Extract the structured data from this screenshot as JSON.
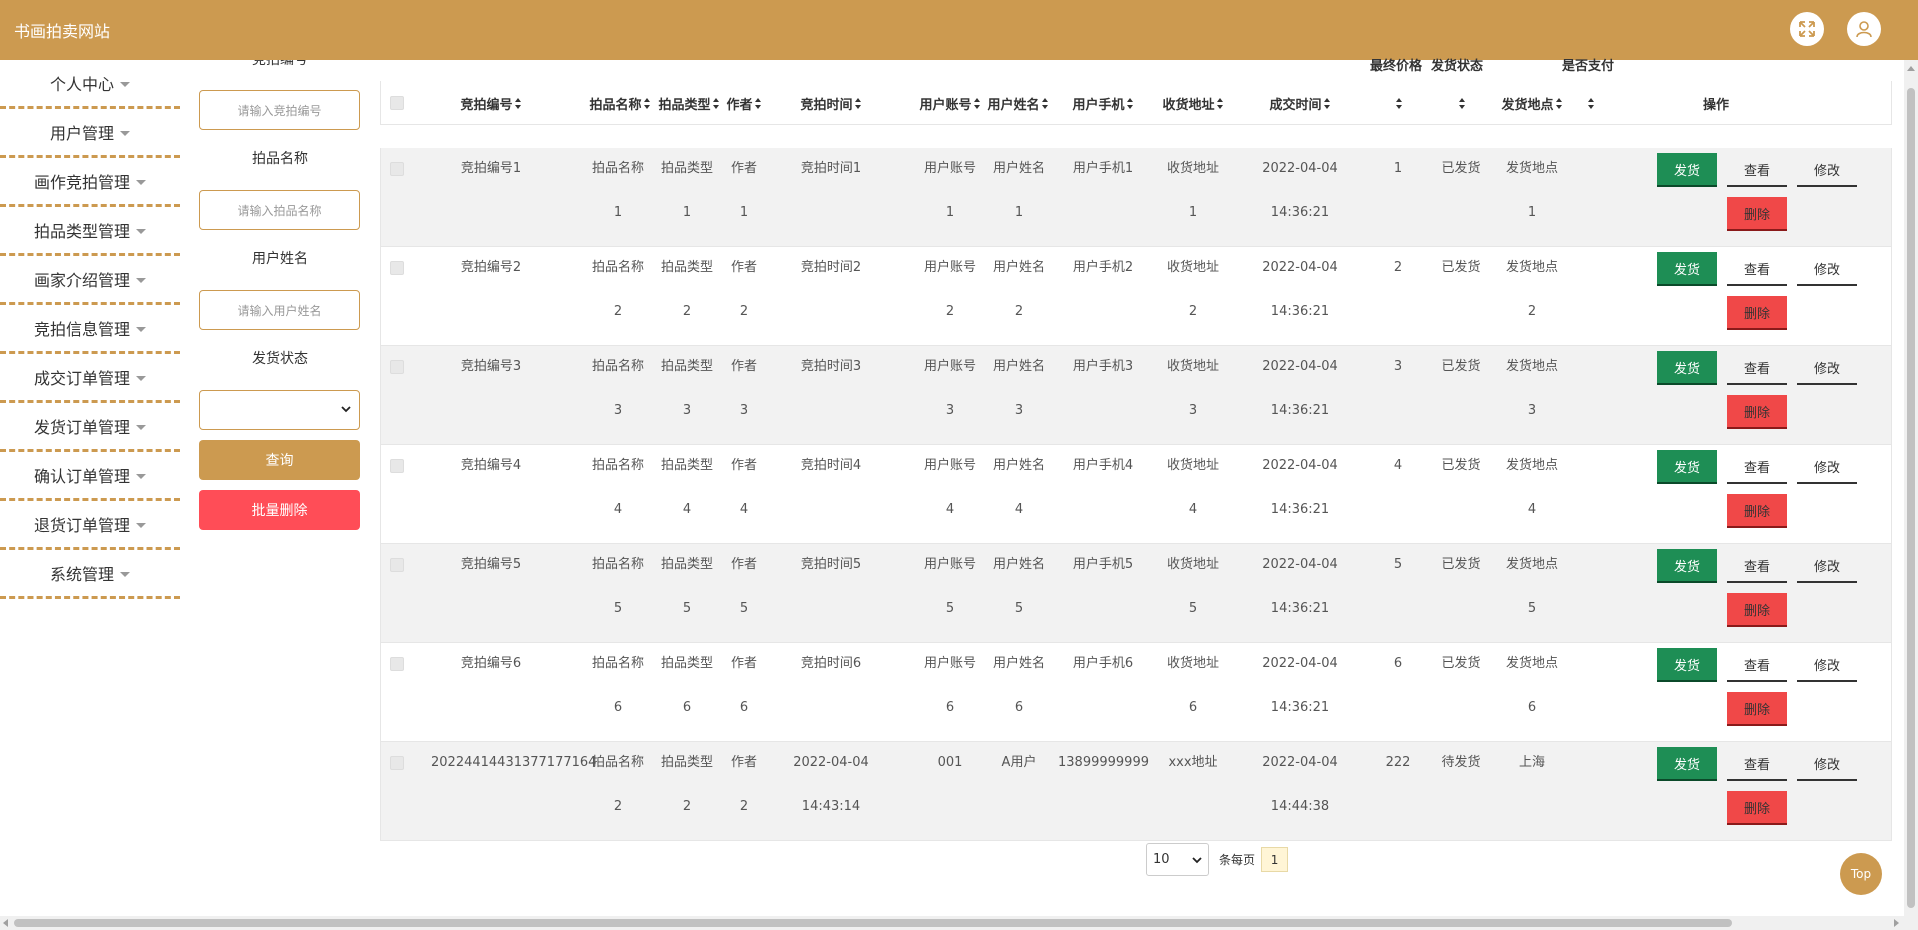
{
  "header": {
    "title": "书画拍卖网站",
    "expand_icon": "expand-icon",
    "user_icon": "user-icon"
  },
  "sidebar": {
    "items": [
      {
        "label": "个人中心"
      },
      {
        "label": "用户管理"
      },
      {
        "label": "画作竞拍管理"
      },
      {
        "label": "拍品类型管理"
      },
      {
        "label": "画家介绍管理"
      },
      {
        "label": "竞拍信息管理"
      },
      {
        "label": "成交订单管理"
      },
      {
        "label": "发货订单管理"
      },
      {
        "label": "确认订单管理"
      },
      {
        "label": "退货订单管理"
      },
      {
        "label": "系统管理"
      }
    ]
  },
  "filter": {
    "top_label": "竞拍编号",
    "auction_no_placeholder": "请输入竞拍编号",
    "item_name_label": "拍品名称",
    "item_name_placeholder": "请输入拍品名称",
    "user_name_label": "用户姓名",
    "user_name_placeholder": "请输入用户姓名",
    "ship_status_label": "发货状态",
    "ship_status_value": "",
    "query_label": "查询",
    "batch_delete_label": "批量删除"
  },
  "table": {
    "top_labels": {
      "final_price": "最终价格",
      "ship_status": "发货状态",
      "paid": "是否支付"
    },
    "headers": {
      "auction_no": "竞拍编号",
      "item_name": "拍品名称",
      "item_type": "拍品类型",
      "author": "作者",
      "auction_time": "竞拍时间",
      "user_account": "用户账号",
      "user_name": "用户姓名",
      "user_phone": "用户手机",
      "address": "收货地址",
      "deal_time": "成交时间",
      "ship_place": "发货地点",
      "actions": "操作"
    },
    "rows": [
      {
        "auction_no": "竞拍编号1",
        "item_name": "拍品名称",
        "item_name2": "1",
        "item_type": "拍品类型",
        "item_type2": "1",
        "author": "作者",
        "author2": "1",
        "auction_time": "竞拍时间1",
        "auction_time2": "",
        "user_account": "用户账号",
        "user_account2": "1",
        "user_name": "用户姓名",
        "user_name2": "1",
        "user_phone": "用户手机1",
        "address": "收货地址",
        "address2": "1",
        "deal_date": "2022-04-04",
        "deal_clock": "14:36:21",
        "final_price": "1",
        "ship_status": "已发货",
        "ship_place": "发货地点",
        "ship_place2": "1"
      },
      {
        "auction_no": "竞拍编号2",
        "item_name": "拍品名称",
        "item_name2": "2",
        "item_type": "拍品类型",
        "item_type2": "2",
        "author": "作者",
        "author2": "2",
        "auction_time": "竞拍时间2",
        "auction_time2": "",
        "user_account": "用户账号",
        "user_account2": "2",
        "user_name": "用户姓名",
        "user_name2": "2",
        "user_phone": "用户手机2",
        "address": "收货地址",
        "address2": "2",
        "deal_date": "2022-04-04",
        "deal_clock": "14:36:21",
        "final_price": "2",
        "ship_status": "已发货",
        "ship_place": "发货地点",
        "ship_place2": "2"
      },
      {
        "auction_no": "竞拍编号3",
        "item_name": "拍品名称",
        "item_name2": "3",
        "item_type": "拍品类型",
        "item_type2": "3",
        "author": "作者",
        "author2": "3",
        "auction_time": "竞拍时间3",
        "auction_time2": "",
        "user_account": "用户账号",
        "user_account2": "3",
        "user_name": "用户姓名",
        "user_name2": "3",
        "user_phone": "用户手机3",
        "address": "收货地址",
        "address2": "3",
        "deal_date": "2022-04-04",
        "deal_clock": "14:36:21",
        "final_price": "3",
        "ship_status": "已发货",
        "ship_place": "发货地点",
        "ship_place2": "3"
      },
      {
        "auction_no": "竞拍编号4",
        "item_name": "拍品名称",
        "item_name2": "4",
        "item_type": "拍品类型",
        "item_type2": "4",
        "author": "作者",
        "author2": "4",
        "auction_time": "竞拍时间4",
        "auction_time2": "",
        "user_account": "用户账号",
        "user_account2": "4",
        "user_name": "用户姓名",
        "user_name2": "4",
        "user_phone": "用户手机4",
        "address": "收货地址",
        "address2": "4",
        "deal_date": "2022-04-04",
        "deal_clock": "14:36:21",
        "final_price": "4",
        "ship_status": "已发货",
        "ship_place": "发货地点",
        "ship_place2": "4"
      },
      {
        "auction_no": "竞拍编号5",
        "item_name": "拍品名称",
        "item_name2": "5",
        "item_type": "拍品类型",
        "item_type2": "5",
        "author": "作者",
        "author2": "5",
        "auction_time": "竞拍时间5",
        "auction_time2": "",
        "user_account": "用户账号",
        "user_account2": "5",
        "user_name": "用户姓名",
        "user_name2": "5",
        "user_phone": "用户手机5",
        "address": "收货地址",
        "address2": "5",
        "deal_date": "2022-04-04",
        "deal_clock": "14:36:21",
        "final_price": "5",
        "ship_status": "已发货",
        "ship_place": "发货地点",
        "ship_place2": "5"
      },
      {
        "auction_no": "竞拍编号6",
        "item_name": "拍品名称",
        "item_name2": "6",
        "item_type": "拍品类型",
        "item_type2": "6",
        "author": "作者",
        "author2": "6",
        "auction_time": "竞拍时间6",
        "auction_time2": "",
        "user_account": "用户账号",
        "user_account2": "6",
        "user_name": "用户姓名",
        "user_name2": "6",
        "user_phone": "用户手机6",
        "address": "收货地址",
        "address2": "6",
        "deal_date": "2022-04-04",
        "deal_clock": "14:36:21",
        "final_price": "6",
        "ship_status": "已发货",
        "ship_place": "发货地点",
        "ship_place2": "6"
      },
      {
        "auction_no": "20224414431377177164",
        "item_name": "拍品名称",
        "item_name2": "2",
        "item_type": "拍品类型",
        "item_type2": "2",
        "author": "作者",
        "author2": "2",
        "auction_time": "2022-04-04",
        "auction_time2": "14:43:14",
        "user_account": "001",
        "user_account2": "",
        "user_name": "A用户",
        "user_name2": "",
        "user_phone": "13899999999",
        "address": "xxx地址",
        "address2": "",
        "deal_date": "2022-04-04",
        "deal_clock": "14:44:38",
        "final_price": "222",
        "ship_status": "待发货",
        "ship_place": "上海",
        "ship_place2": ""
      }
    ],
    "actions": {
      "ship": "发货",
      "view": "查看",
      "edit": "修改",
      "delete": "删除"
    }
  },
  "pager": {
    "page_size": "10",
    "per_page_label": "条每页",
    "current_page": "1"
  },
  "top_button": {
    "label": "Top"
  },
  "colors": {
    "brand": "#cc9a50",
    "ship_button": "#1e8e55",
    "delete_button": "#f04848",
    "batch_delete": "#ff4d57"
  }
}
